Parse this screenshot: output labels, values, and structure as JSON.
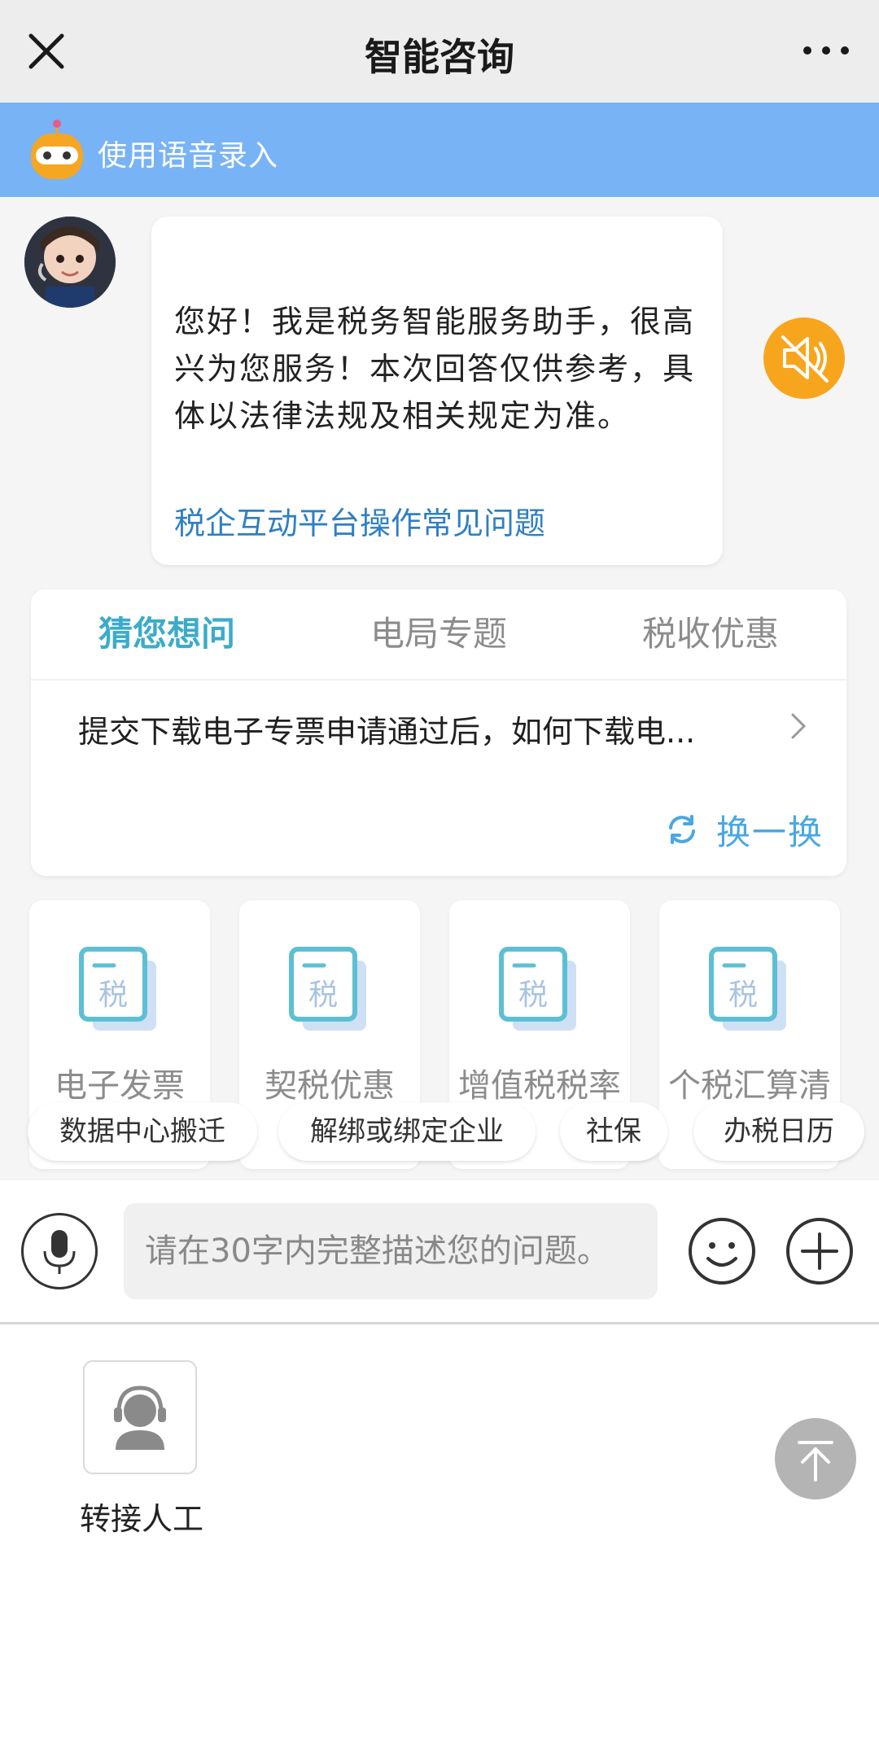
{
  "topbar": {
    "title": "智能咨询",
    "close_icon": "close-icon",
    "more_icon": "more-icon"
  },
  "voice_banner": {
    "text": "使用语音录入",
    "color": "#78b3f6"
  },
  "chat": {
    "message": "您好！我是税务智能服务助手，很高兴为您服务！本次回答仅供参考，具体以法律法规及相关规定为准。",
    "faq_link": "税企互动平台操作常见问题",
    "mute_color": "#f8a51e"
  },
  "tabs": [
    {
      "label": "猜您想问",
      "active": true
    },
    {
      "label": "电局专题",
      "active": false
    },
    {
      "label": "税收优惠",
      "active": false
    }
  ],
  "suggested_question": "提交下载电子专票申请通过后，如何下载电...",
  "refresh_label": "换一换",
  "shortcuts": [
    {
      "label": "电子发票",
      "icon_text": "税"
    },
    {
      "label": "契税优惠",
      "icon_text": "税"
    },
    {
      "label": "增值税税率",
      "icon_text": "税"
    },
    {
      "label": "个税汇算清缴",
      "icon_text": "税"
    }
  ],
  "chips": [
    "数据中心搬迁",
    "解绑或绑定企业",
    "社保",
    "办税日历"
  ],
  "input": {
    "placeholder": "请在30字内完整描述您的问题。"
  },
  "panel": {
    "agent_label": "转接人工"
  },
  "colors": {
    "accent_tab": "#3cabc9",
    "link": "#2f7fc4",
    "refresh": "#4ba7e0"
  }
}
